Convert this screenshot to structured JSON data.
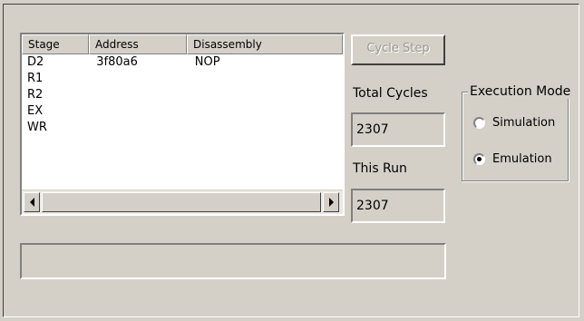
{
  "listview": {
    "columns": [
      "Stage",
      "Address",
      "Disassembly"
    ],
    "rows": [
      {
        "stage": "D2",
        "address": "3f80a6",
        "disassembly": "NOP"
      },
      {
        "stage": "R1",
        "address": "",
        "disassembly": ""
      },
      {
        "stage": "R2",
        "address": "",
        "disassembly": ""
      },
      {
        "stage": "EX",
        "address": "",
        "disassembly": ""
      },
      {
        "stage": "WR",
        "address": "",
        "disassembly": ""
      }
    ]
  },
  "controls": {
    "cycle_step_label": "Cycle Step",
    "cycle_step_enabled": false,
    "total_cycles_label": "Total Cycles",
    "total_cycles_value": "2307",
    "this_run_label": "This Run",
    "this_run_value": "2307"
  },
  "execution_mode": {
    "title": "Execution Mode",
    "options": [
      "Simulation",
      "Emulation"
    ],
    "selected": "Emulation"
  },
  "status": {
    "text": ""
  },
  "colors": {
    "face": "#d4d0c8",
    "disabled_text": "#9a9890",
    "window": "#ffffff"
  }
}
